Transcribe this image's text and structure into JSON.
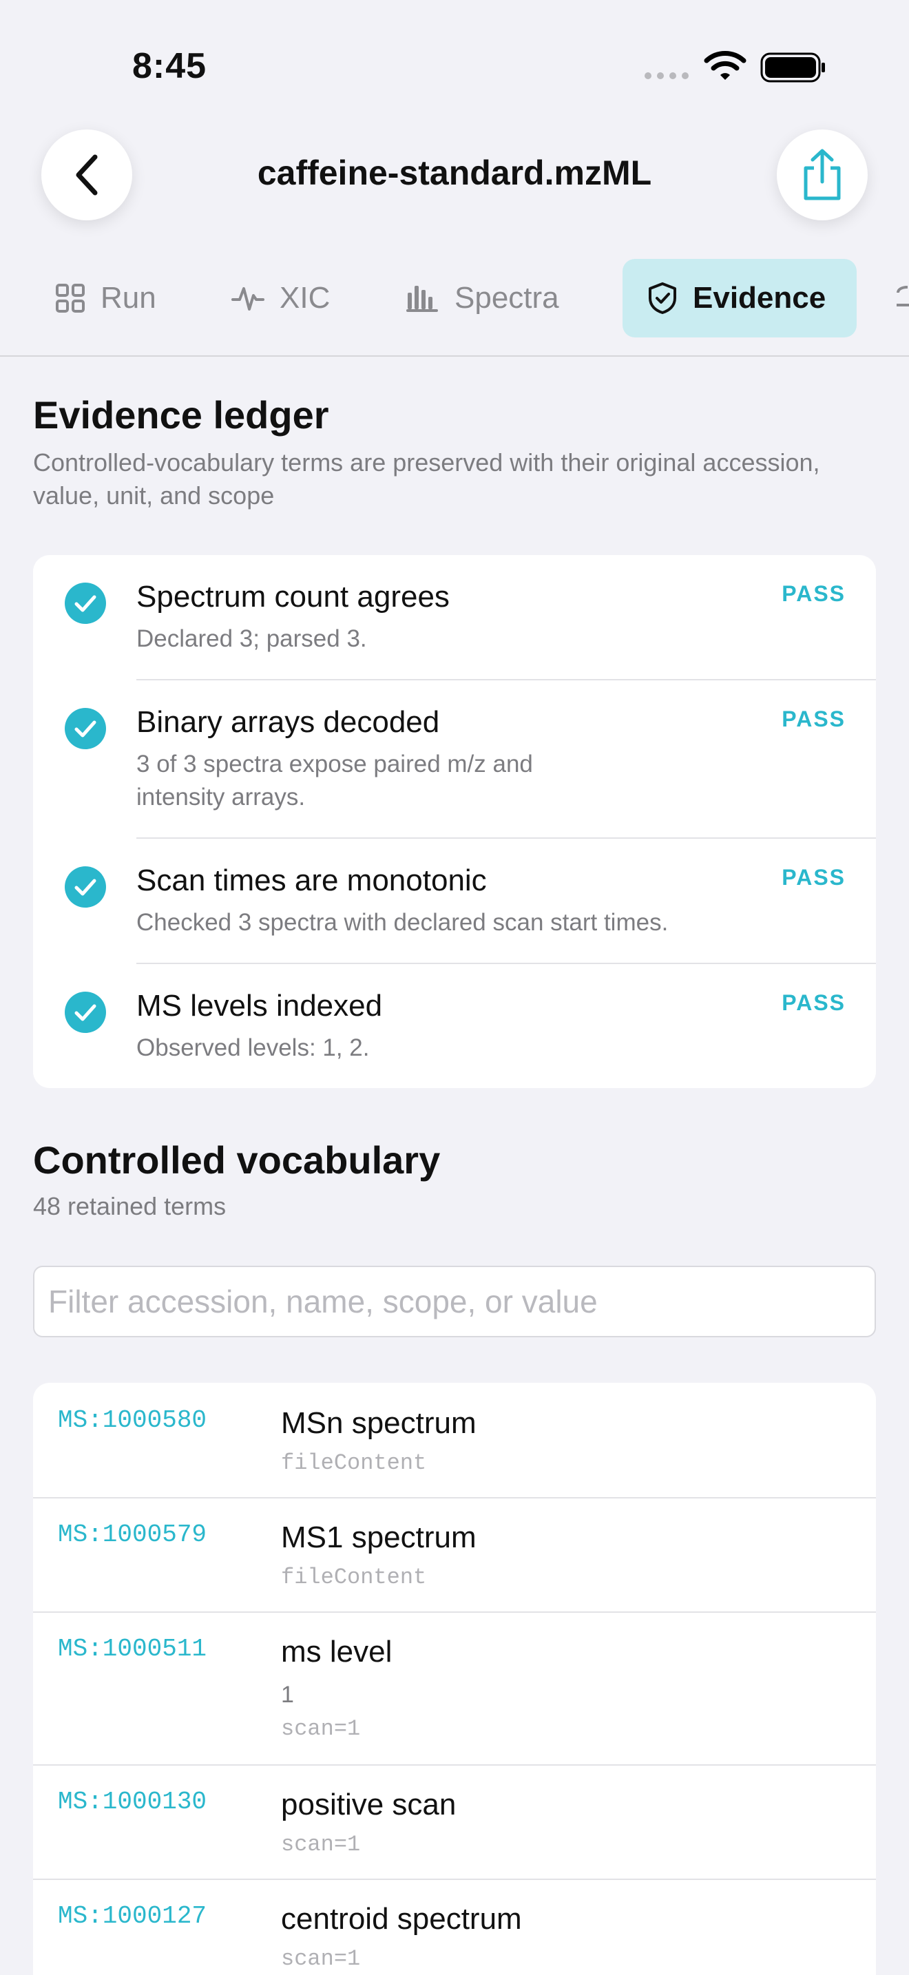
{
  "status_bar": {
    "time": "8:45"
  },
  "nav": {
    "title": "caffeine-standard.mzML"
  },
  "tabs": [
    {
      "label": "Run",
      "icon": "grid-icon"
    },
    {
      "label": "XIC",
      "icon": "waveform-icon"
    },
    {
      "label": "Spectra",
      "icon": "bar-chart-icon"
    },
    {
      "label": "Evidence",
      "icon": "shield-check-icon",
      "selected": true
    }
  ],
  "evidence": {
    "title": "Evidence ledger",
    "subtitle": "Controlled-vocabulary terms are preserved with their original accession, value, unit, and scope",
    "checks": [
      {
        "title": "Spectrum count agrees",
        "detail": "Declared 3; parsed 3.",
        "status": "PASS"
      },
      {
        "title": "Binary arrays decoded",
        "detail": "3 of 3 spectra expose paired m/z and intensity arrays.",
        "status": "PASS"
      },
      {
        "title": "Scan times are monotonic",
        "detail": "Checked 3 spectra with declared scan start times.",
        "status": "PASS"
      },
      {
        "title": "MS levels indexed",
        "detail": "Observed levels: 1, 2.",
        "status": "PASS"
      }
    ]
  },
  "vocabulary": {
    "title": "Controlled vocabulary",
    "subtitle": "48 retained terms",
    "filter_placeholder": "Filter accession, name, scope, or value",
    "terms": [
      {
        "accession": "MS:1000580",
        "name": "MSn spectrum",
        "value": "",
        "scope": "fileContent"
      },
      {
        "accession": "MS:1000579",
        "name": "MS1 spectrum",
        "value": "",
        "scope": "fileContent"
      },
      {
        "accession": "MS:1000511",
        "name": "ms level",
        "value": "1",
        "scope": "scan=1"
      },
      {
        "accession": "MS:1000130",
        "name": "positive scan",
        "value": "",
        "scope": "scan=1"
      },
      {
        "accession": "MS:1000127",
        "name": "centroid spectrum",
        "value": "",
        "scope": "scan=1"
      }
    ]
  },
  "colors": {
    "accent": "#2ab7cc",
    "selected_tab_bg": "#c9ecf1",
    "background": "#f2f2f7"
  }
}
